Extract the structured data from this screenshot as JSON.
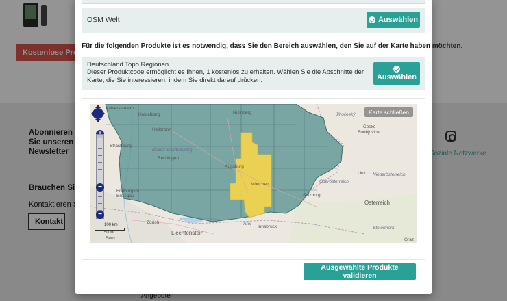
{
  "background": {
    "free_products_button": "Kostenlose Produkte",
    "newsletter_title": "Abonnieren Sie unseren Newsletter für Nachrichten Tipps",
    "help_title": "Brauchen Sie Hilfe?",
    "help_text": "Kontaktieren Sie uns",
    "contact_button": "Kontakt",
    "social_text": "Soziale Netzwerke",
    "footer_link": "Angebote"
  },
  "modal": {
    "osm_product": {
      "name": "OSM Welt",
      "button": "Auswählen"
    },
    "intro": "Für die folgenden Produkte ist es notwendig, dass Sie den Bereich auswählen, den Sie auf der Karte haben möchten.",
    "topo_product": {
      "name": "Deutschland Topo Regionen",
      "description": "Dieser Produktcode ermöglicht es Ihnen, 1 kostenlos zu erhalten. Wählen Sie die Abschnitte der Karte, die Sie interessieren, indem Sie direkt darauf drücken.",
      "button": "Auswählen"
    },
    "map": {
      "close_button": "Karte schließen",
      "scale_top": "100 km",
      "scale_bottom": "50 mi",
      "labels": {
        "kaiserslautern": "Kaiserslautern",
        "heidelberg": "Heidelberg",
        "nuernberg": "Nürnberg",
        "jihocesky": "Jihočeský",
        "ceske": "České",
        "budejovice": "Budějovice",
        "heilbronn": "Heilbronn",
        "strasbourg": "Strasbourg",
        "bw": "Baden-Württemberg",
        "reutlingen": "Reutlingen",
        "augsburg": "Augsburg",
        "muenchen": "München",
        "linz": "Linz",
        "oberoesterreich": "Oberösterreich",
        "niederoesterreich": "Niederösterreich",
        "freiburg": "Freiburg im Breisgau",
        "salzburg": "Salzburg",
        "oesterreich": "Österreich",
        "zuerich": "Zürich",
        "tirol": "Tirol",
        "innsbruck": "Innsbruck",
        "liechtenstein": "Liechtenstein",
        "steiermark": "Steiermark",
        "bern": "Bern",
        "graz": "Graz"
      }
    },
    "validate_button": "Ausgewählte Produkte validieren"
  },
  "colors": {
    "accent": "#2aa197",
    "region_fill": "#5f9695",
    "selected_region": "#f4d54a"
  }
}
